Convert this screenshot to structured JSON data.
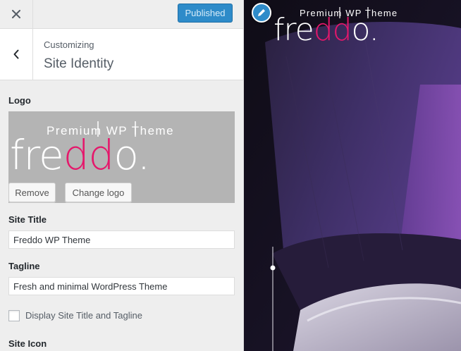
{
  "topbar": {
    "close_icon": "close-icon",
    "publish_label": "Published",
    "publish_color": "#2e8bc9"
  },
  "section": {
    "back_icon": "chevron-left-icon",
    "crumb": "Customizing",
    "title": "Site Identity"
  },
  "logo": {
    "label": "Logo",
    "tagline_text": "Premium WP Theme",
    "wordmark_light": "fre",
    "wordmark_accent": "dd",
    "wordmark_end": "o.",
    "accent_color": "#e5176b",
    "remove_label": "Remove",
    "change_label": "Change logo"
  },
  "site_title": {
    "label": "Site Title",
    "value": "Freddo WP Theme"
  },
  "tagline": {
    "label": "Tagline",
    "value": "Fresh and minimal WordPress Theme"
  },
  "display_title": {
    "label": "Display Site Title and Tagline",
    "checked": false
  },
  "site_icon": {
    "label": "Site Icon"
  },
  "preview": {
    "edit_icon": "pencil-icon"
  }
}
